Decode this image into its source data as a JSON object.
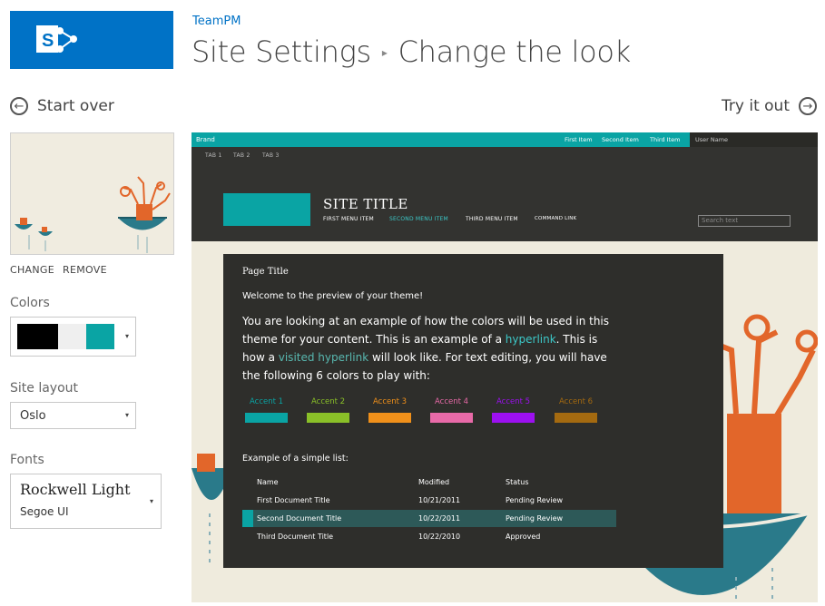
{
  "header": {
    "site_name": "TeamPM",
    "breadcrumb_parent": "Site Settings",
    "breadcrumb_sep": "▸",
    "breadcrumb_current": "Change the look"
  },
  "nav": {
    "start_over": "Start over",
    "try_it_out": "Try it out"
  },
  "left_panel": {
    "change": "CHANGE",
    "remove": "REMOVE",
    "colors_label": "Colors",
    "color_swatches": [
      "#000000",
      "#efefef",
      "#0aa4a4"
    ],
    "layout_label": "Site layout",
    "layout_value": "Oslo",
    "fonts_label": "Fonts",
    "font_heading": "Rockwell Light",
    "font_body": "Segoe UI"
  },
  "preview": {
    "brand": "Brand",
    "suite_links": [
      "First Item",
      "Second Item",
      "Third Item"
    ],
    "user_name": "User Name",
    "tabs": [
      "TAB 1",
      "TAB 2",
      "TAB 3"
    ],
    "site_title": "SITE TITLE",
    "menu": [
      "FIRST MENU ITEM",
      "SECOND MENU ITEM",
      "THIRD MENU ITEM",
      "COMMAND LINK"
    ],
    "search_placeholder": "Search text",
    "page_title": "Page Title",
    "welcome": "Welcome to the preview of your theme!",
    "para_1": "You are looking at an example of how the colors will be used in this theme for your content. This is an example of a ",
    "hyperlink": "hyperlink",
    "para_2": ". This is how a ",
    "visited_hyperlink": "visited hyperlink",
    "para_3": " will look like. For text editing, you will have the following 6 colors to play with:",
    "accents": [
      {
        "label": "Accent 1",
        "color": "#0aa4a4"
      },
      {
        "label": "Accent 2",
        "color": "#8ac028"
      },
      {
        "label": "Accent 3",
        "color": "#f0901a"
      },
      {
        "label": "Accent 4",
        "color": "#e86aa8"
      },
      {
        "label": "Accent 5",
        "color": "#9c10f0"
      },
      {
        "label": "Accent 6",
        "color": "#a46a10"
      }
    ],
    "list_title": "Example of a simple list:",
    "list_headers": [
      "Name",
      "Modified",
      "Status"
    ],
    "list_rows": [
      [
        "First Document Title",
        "10/21/2011",
        "Pending Review"
      ],
      [
        "Second Document Title",
        "10/22/2011",
        "Pending Review"
      ],
      [
        "Third Document Title",
        "10/22/2010",
        "Approved"
      ]
    ]
  }
}
